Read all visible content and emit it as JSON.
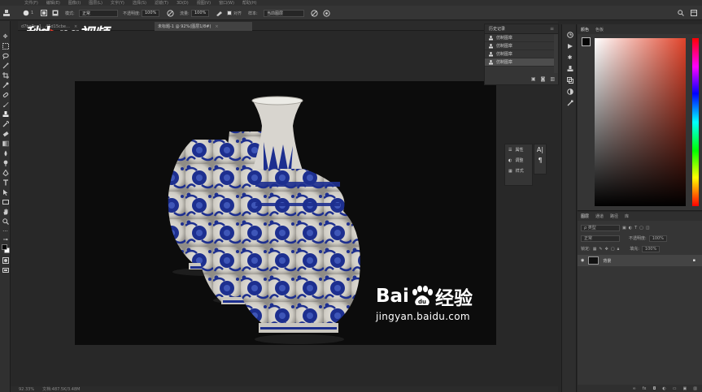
{
  "menubar": {
    "items": [
      "文件(F)",
      "编辑(E)",
      "图像(I)",
      "图层(L)",
      "文字(Y)",
      "选择(S)",
      "滤镜(T)",
      "3D(D)",
      "视图(V)",
      "窗口(W)",
      "帮助(H)"
    ]
  },
  "options": {
    "brush_size": "1",
    "mode_label": "模式:",
    "mode_value": "正常",
    "opacity_label": "不透明度:",
    "opacity_value": "100%",
    "flow_label": "流量:",
    "flow_value": "100%",
    "align_label": "对齐",
    "sample_label": "样本:",
    "sample_value": "当前图层"
  },
  "tabs": [
    {
      "label": "d7ba0ea1…45d15cbe…",
      "active": false
    },
    {
      "label": "未标题-1 @ 92%(图层1/8#)",
      "active": true
    }
  ],
  "logo": {
    "prefix": "秒",
    "middle": "d",
    "suffix": "ng视频"
  },
  "watermark": {
    "brand_left": "Bai",
    "brand_right": "经验",
    "url": "jingyan.baidu.com"
  },
  "history": {
    "title": "历史记录",
    "items": [
      "仿制图章",
      "仿制图章",
      "仿制图章",
      "仿制图章"
    ],
    "selected_index": 3
  },
  "mini_panel": {
    "items": [
      "属性",
      "调整",
      "样式"
    ]
  },
  "color_panel": {
    "tabs": [
      "颜色",
      "色板"
    ],
    "foreground": "#050505",
    "background": "#ffffff",
    "hue_color": "#e0432a"
  },
  "layers_panel": {
    "tabs": [
      "图层",
      "通道",
      "路径",
      "库"
    ],
    "kind_label": "ρ 类型",
    "blend_mode": "正常",
    "opacity_label": "不透明度:",
    "opacity_value": "100%",
    "lock_label": "锁定:",
    "fill_label": "填充:",
    "fill_value": "100%",
    "layer_name": "背景"
  },
  "status": {
    "zoom": "92.33%",
    "doc": "文档:487.5K/3.48M"
  },
  "colors": {
    "accent_blue": "#1d2f8f",
    "canvas_bg": "#0c0c0c"
  }
}
